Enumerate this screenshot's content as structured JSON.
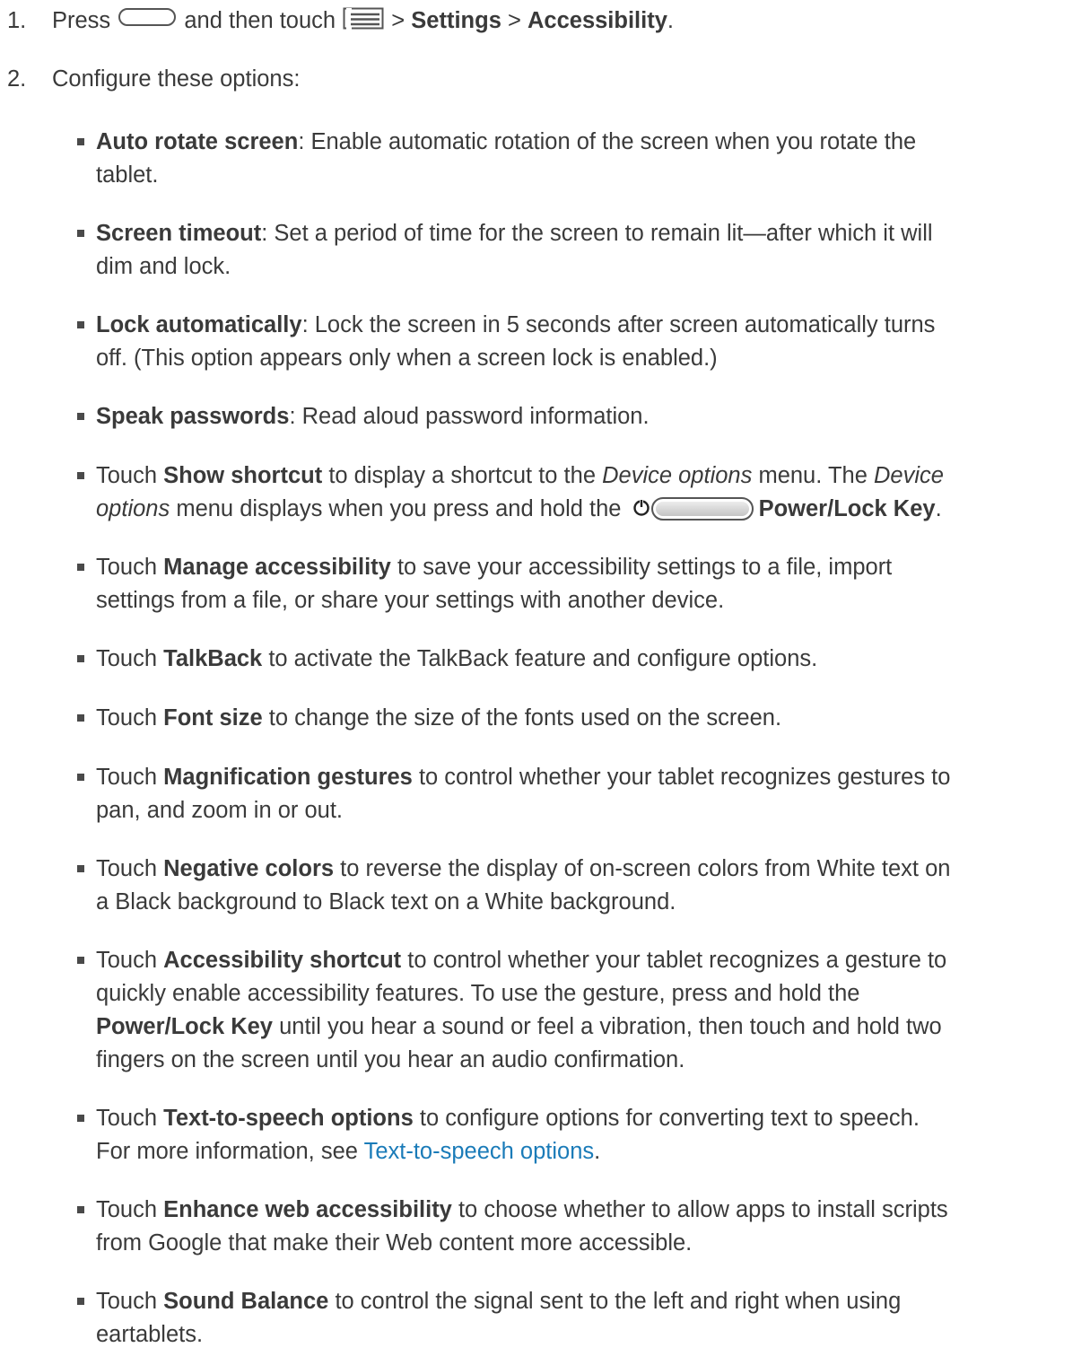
{
  "steps": [
    {
      "number": "1.",
      "t1": "Press",
      "t2": "and then touch",
      "t3": ">",
      "settings": "Settings",
      "t4": ">",
      "accessibility": "Accessibility",
      "t5": ".",
      "icons": [
        "home-button-icon",
        "menu-icon"
      ]
    },
    {
      "number": "2.",
      "text": "Configure these options:"
    }
  ],
  "items": [
    {
      "bold": "Auto rotate screen",
      "rest1": ": Enable automatic rotation of the screen when you rotate the",
      "rest2": "tablet."
    },
    {
      "bold": "Screen timeout",
      "rest1": ": Set a period of time for the screen to remain lit—after which it will",
      "rest2": "dim and lock."
    },
    {
      "bold": "Lock automatically",
      "rest1": ": Lock the screen in 5 seconds after screen automatically turns",
      "rest2": "off. (This option appears only when a screen lock is enabled.)"
    },
    {
      "bold": "Speak passwords",
      "rest1": ": Read aloud password information."
    },
    {
      "pre": "Touch",
      "bold": "Show shortcut",
      "mid1": "to display a shortcut to the",
      "ital1": "Device options",
      "mid2": "menu. The",
      "ital2a": "Device",
      "ital2b": "options",
      "mid3": "menu displays when you press and hold the",
      "bold2": "Power/Lock Key",
      "end": ".",
      "icons": [
        "power-icon",
        "power-button-icon"
      ]
    },
    {
      "pre": "Touch",
      "bold": "Manage accessibility",
      "rest1": "to save your accessibility settings to a file, import",
      "rest2": "settings from a file, or share your settings with another device."
    },
    {
      "pre": "Touch",
      "bold": "TalkBack",
      "rest1": "to activate the TalkBack feature and configure options."
    },
    {
      "pre": "Touch",
      "bold": "Font size",
      "rest1": "to change the size of the fonts used on the screen."
    },
    {
      "pre": "Touch",
      "bold": "Magnification gestures",
      "rest1": "to control whether your tablet recognizes gestures to",
      "rest2": "pan, and zoom in or out."
    },
    {
      "pre": "Touch",
      "bold": "Negative colors",
      "rest1": "to reverse the display of on-screen colors from White text on",
      "rest2": "a Black background to Black text on a White background."
    },
    {
      "pre": "Touch",
      "bold": "Accessibility shortcut",
      "rest1": "to control whether your tablet recognizes a gesture to",
      "rest2": "quickly enable accessibility features. To use the gesture, press and hold the",
      "bold2": "Power/Lock Key",
      "rest3": "until you hear a sound or feel a vibration, then touch and hold two",
      "rest4": "fingers on the screen until you hear an audio confirmation."
    },
    {
      "pre": "Touch",
      "bold": "Text-to-speech options",
      "rest1": "to configure options for converting text to speech.",
      "rest2": "For more information, see",
      "link": "Text-to-speech options",
      "end": "."
    },
    {
      "pre": "Touch",
      "bold": "Enhance web accessibility",
      "rest1": "to choose whether to allow apps to install scripts",
      "rest2": "from Google that make their Web content more accessible."
    },
    {
      "pre": "Touch",
      "bold": "Sound Balance",
      "rest1": "to control the signal sent to the left and right when using",
      "rest2": "eartablets."
    }
  ],
  "colors": {
    "text": "#3a3a3a",
    "link": "#1a7bb8"
  }
}
